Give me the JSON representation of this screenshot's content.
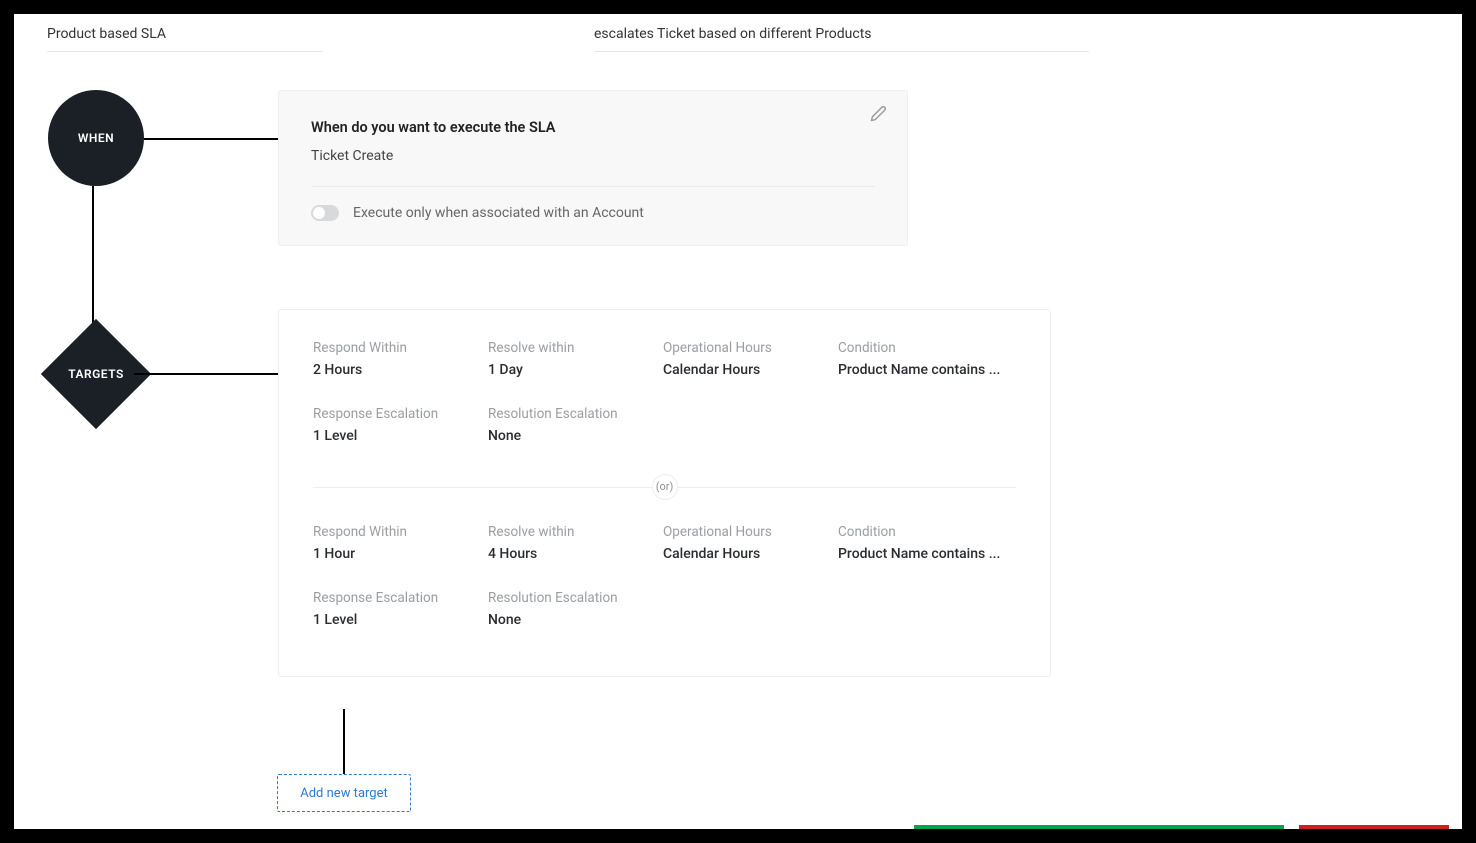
{
  "header": {
    "title": "Product based SLA",
    "description": "escalates Ticket based on different Products"
  },
  "flow": {
    "when_node": "WHEN",
    "targets_node": "TARGETS"
  },
  "when_card": {
    "question": "When do you want to execute the SLA",
    "trigger": "Ticket Create",
    "account_toggle_label": "Execute only when associated with an Account",
    "account_toggle_on": false
  },
  "targets_card": {
    "labels": {
      "respond_within": "Respond Within",
      "resolve_within": "Resolve within",
      "operational_hours": "Operational Hours",
      "condition": "Condition",
      "response_escalation": "Response Escalation",
      "resolution_escalation": "Resolution Escalation"
    },
    "or_text": "(or)",
    "rows": [
      {
        "respond_within": "2 Hours",
        "resolve_within": "1 Day",
        "operational_hours": "Calendar Hours",
        "condition": "Product Name contains ...",
        "response_escalation": "1 Level",
        "resolution_escalation": "None"
      },
      {
        "respond_within": "1 Hour",
        "resolve_within": "4 Hours",
        "operational_hours": "Calendar Hours",
        "condition": "Product Name contains ...",
        "response_escalation": "1 Level",
        "resolution_escalation": "None"
      }
    ]
  },
  "add_target_label": "Add new target"
}
